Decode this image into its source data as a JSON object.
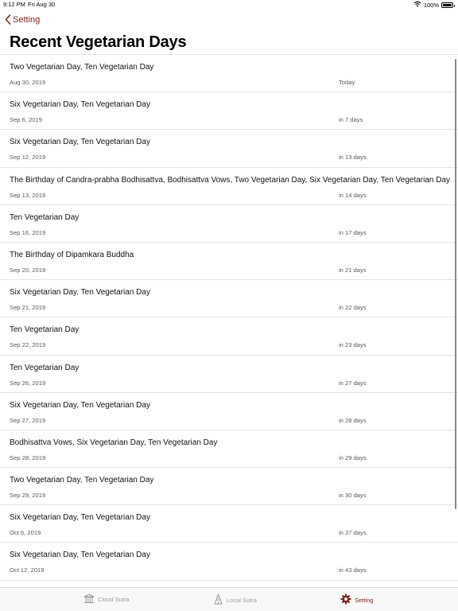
{
  "status_bar": {
    "time": "9:12 PM",
    "date": "Fri Aug 30",
    "battery": "100%"
  },
  "nav": {
    "back_label": "Setting",
    "title": "Recent Vegetarian Days"
  },
  "rows": [
    {
      "title": "Two Vegetarian Day, Ten Vegetarian Day",
      "date": "Aug 30, 2019",
      "relative": "Today"
    },
    {
      "title": "Six Vegetarian Day, Ten Vegetarian Day",
      "date": "Sep 6, 2019",
      "relative": "in 7 days"
    },
    {
      "title": "Six Vegetarian Day, Ten Vegetarian Day",
      "date": "Sep 12, 2019",
      "relative": "in 13 days"
    },
    {
      "title": "The Birthday of Candra-prabha Bodhisattva, Bodhisattva Vows, Two Vegetarian Day, Six Vegetarian Day, Ten Vegetarian Day",
      "date": "Sep 13, 2019",
      "relative": "in 14 days"
    },
    {
      "title": "Ten Vegetarian Day",
      "date": "Sep 16, 2019",
      "relative": "in 17 days"
    },
    {
      "title": "The Birthday of Dipamkara Buddha",
      "date": "Sep 20, 2019",
      "relative": "in 21 days"
    },
    {
      "title": "Six Vegetarian Day, Ten Vegetarian Day",
      "date": "Sep 21, 2019",
      "relative": "in 22 days"
    },
    {
      "title": "Ten Vegetarian Day",
      "date": "Sep 22, 2019",
      "relative": "in 23 days"
    },
    {
      "title": "Ten Vegetarian Day",
      "date": "Sep 26, 2019",
      "relative": "in 27 days"
    },
    {
      "title": "Six Vegetarian Day, Ten Vegetarian Day",
      "date": "Sep 27, 2019",
      "relative": "in 28 days"
    },
    {
      "title": "Bodhisattva Vows, Six Vegetarian Day, Ten Vegetarian Day",
      "date": "Sep 28, 2019",
      "relative": "in 29 days"
    },
    {
      "title": "Two Vegetarian Day, Ten Vegetarian Day",
      "date": "Sep 29, 2019",
      "relative": "in 30 days"
    },
    {
      "title": "Six Vegetarian Day, Ten Vegetarian Day",
      "date": "Oct 6, 2019",
      "relative": "in 37 days"
    },
    {
      "title": "Six Vegetarian Day, Ten Vegetarian Day",
      "date": "Oct 12, 2019",
      "relative": "in 43 days"
    }
  ],
  "tabs": [
    {
      "label": "Cloud Sutra",
      "icon": "temple-icon",
      "active": false
    },
    {
      "label": "Local Sutra",
      "icon": "pagoda-icon",
      "active": false
    },
    {
      "label": "Setting",
      "icon": "gear-icon",
      "active": true
    }
  ],
  "colors": {
    "accent": "#7a2a1f",
    "inactive_tab": "#9a9a9a"
  }
}
